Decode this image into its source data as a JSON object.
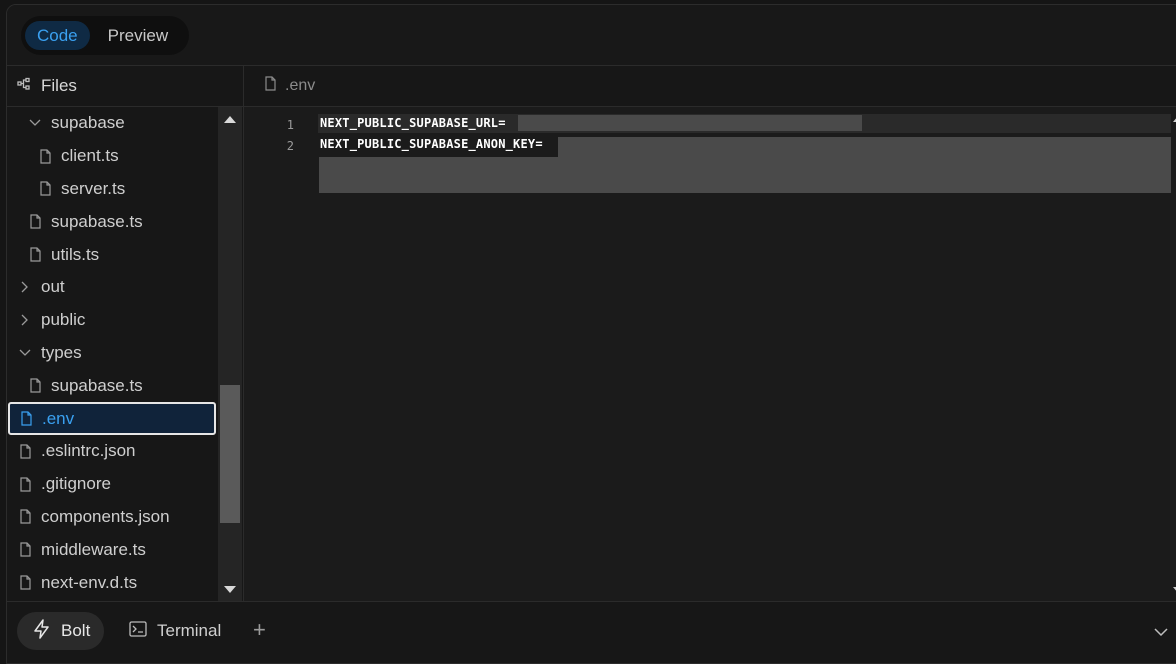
{
  "topbar": {
    "tabs": [
      {
        "label": "Code",
        "active": true
      },
      {
        "label": "Preview",
        "active": false
      }
    ]
  },
  "files_panel": {
    "title": "Files",
    "tree": [
      {
        "label": "supabase",
        "type": "folder",
        "open": true,
        "depth": 1
      },
      {
        "label": "client.ts",
        "type": "file",
        "depth": 2
      },
      {
        "label": "server.ts",
        "type": "file",
        "depth": 2
      },
      {
        "label": "supabase.ts",
        "type": "file",
        "depth": 1
      },
      {
        "label": "utils.ts",
        "type": "file",
        "depth": 1
      },
      {
        "label": "out",
        "type": "folder",
        "open": false,
        "depth": 0
      },
      {
        "label": "public",
        "type": "folder",
        "open": false,
        "depth": 0
      },
      {
        "label": "types",
        "type": "folder",
        "open": true,
        "depth": 0
      },
      {
        "label": "supabase.ts",
        "type": "file",
        "depth": 1
      },
      {
        "label": ".env",
        "type": "file",
        "depth": 0,
        "selected": true
      },
      {
        "label": ".eslintrc.json",
        "type": "file",
        "depth": 0
      },
      {
        "label": ".gitignore",
        "type": "file",
        "depth": 0
      },
      {
        "label": "components.json",
        "type": "file",
        "depth": 0
      },
      {
        "label": "middleware.ts",
        "type": "file",
        "depth": 0
      },
      {
        "label": "next-env.d.ts",
        "type": "file",
        "depth": 0
      }
    ]
  },
  "editor": {
    "filename": ".env",
    "lines": [
      {
        "no": "1",
        "text": "NEXT_PUBLIC_SUPABASE_URL="
      },
      {
        "no": "2",
        "text": "NEXT_PUBLIC_SUPABASE_ANON_KEY="
      }
    ]
  },
  "bottombar": {
    "tabs": [
      {
        "label": "Bolt",
        "active": true
      },
      {
        "label": "Terminal",
        "active": false
      }
    ],
    "add_label": "+"
  },
  "colors": {
    "accent": "#3aa0f0",
    "background": "#171717",
    "selection_bg": "#10233a"
  }
}
